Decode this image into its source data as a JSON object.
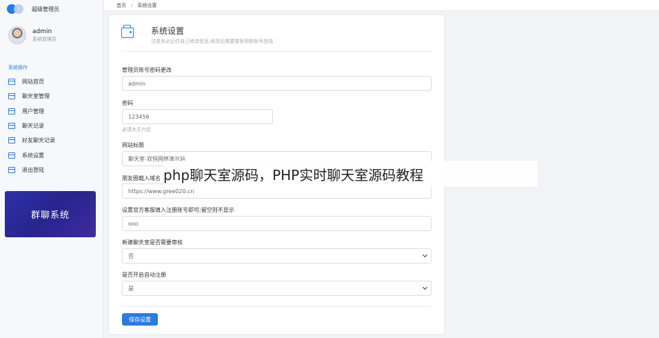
{
  "brand": {
    "title": "超级管理员"
  },
  "user": {
    "name": "admin",
    "role": "系统管理员"
  },
  "menu": {
    "heading": "系统操作",
    "items": [
      "网站首页",
      "聊天室管理",
      "用户管理",
      "聊天记录",
      "好友聊天记录",
      "系统设置",
      "退出登陆"
    ]
  },
  "banner": {
    "text": "群聊系统"
  },
  "breadcrumb": {
    "home": "首页",
    "sep": "/",
    "current": "系统设置"
  },
  "card": {
    "title": "系统设置",
    "subtitle": "注意务必记住自己修改信息,修改后需要重新用新账号登陆"
  },
  "form": {
    "account_label": "管理员账号密码更改",
    "account_value": "admin",
    "password_label": "密码",
    "password_value": "123456",
    "password_hint": "必须大于六位",
    "site_title_label": "网站标题",
    "site_title_value": "聊天室-双恒网络演示站",
    "url_label": "朋友圈载入域名",
    "url_value": "https://www.gree020.cn",
    "service_label": "设置官方客服填入注册账号即可;留空则不显示",
    "service_value": "ooo",
    "review_label": "新建聊天室是否需要审核",
    "review_value": "否",
    "autoreg_label": "是否开启自动注册",
    "autoreg_value": "是",
    "save_label": "保存设置"
  },
  "overlay": {
    "text": "php聊天室源码，PHP实时聊天室源码教程"
  },
  "colors": {
    "accent": "#2a7ae2",
    "banner": "#2f2fa8"
  }
}
